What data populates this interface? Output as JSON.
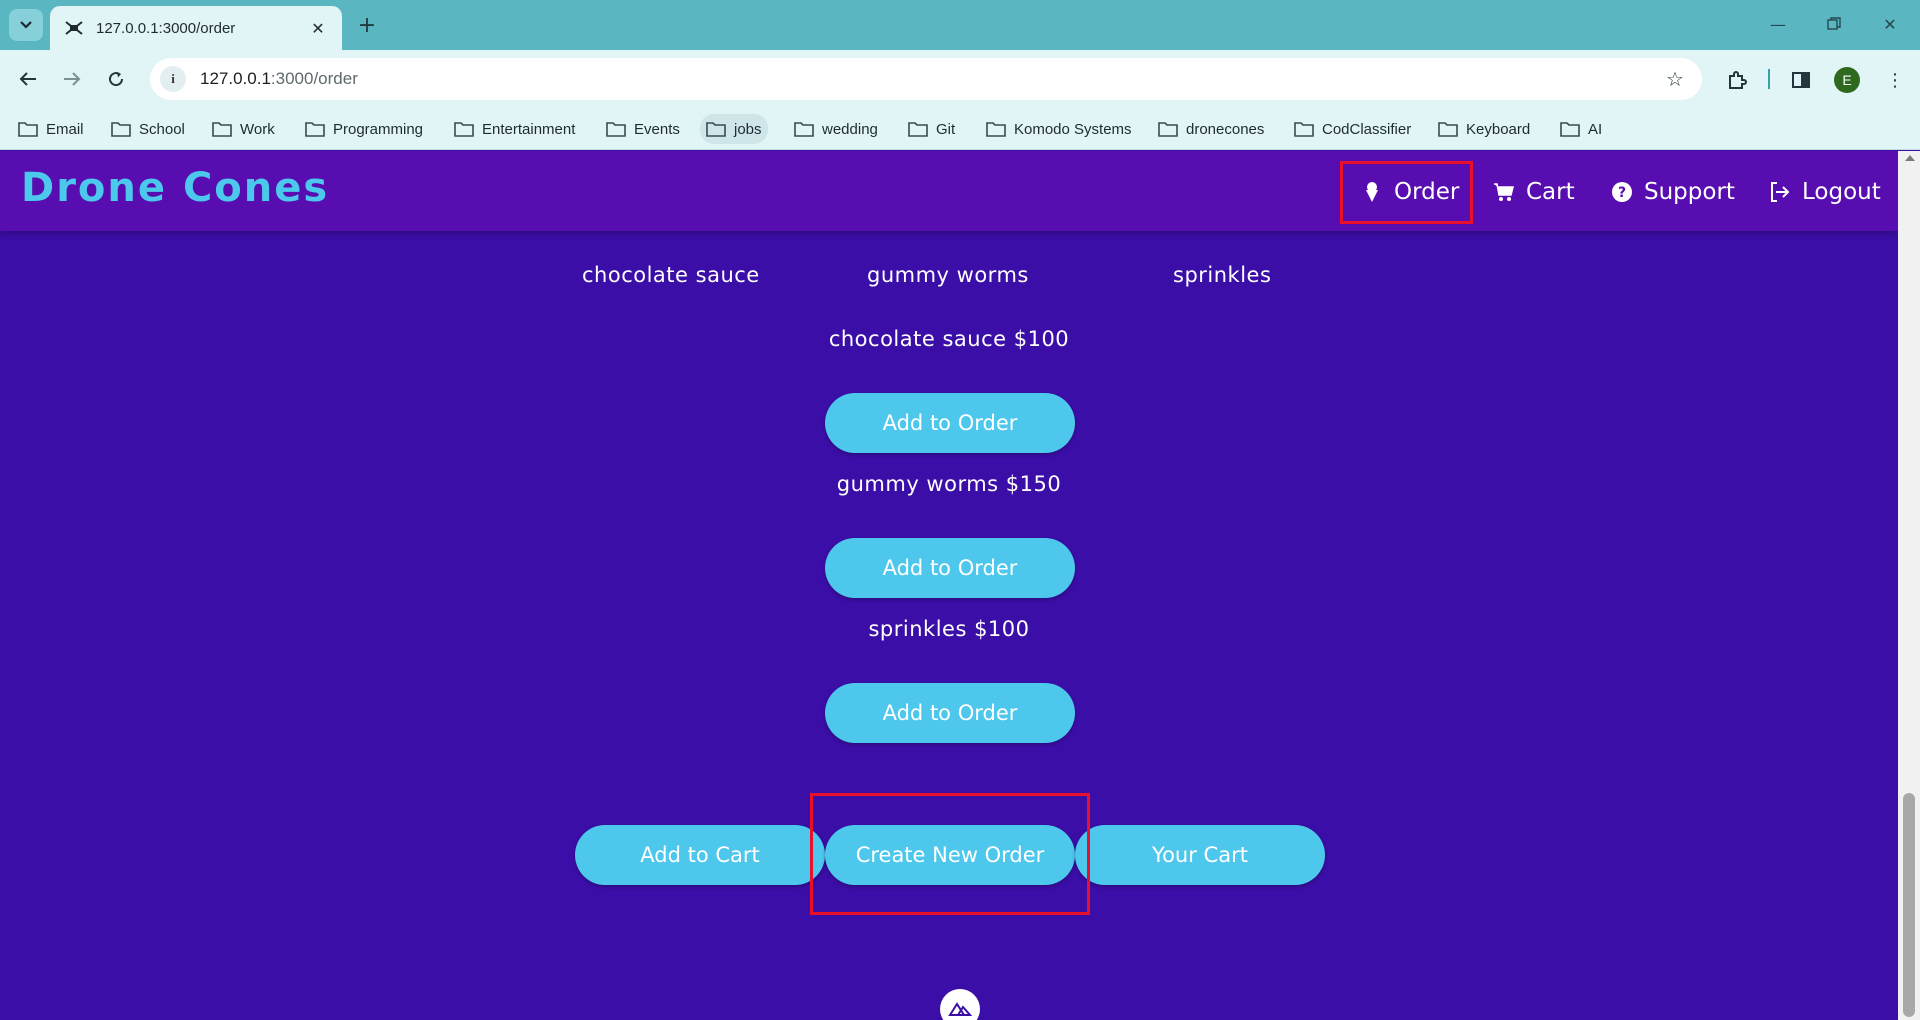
{
  "browser": {
    "tab": {
      "title": "127.0.0.1:3000/order"
    },
    "address": {
      "host": "127.0.0.1",
      "path": ":3000/order"
    },
    "avatar_letter": "E",
    "bookmarks": [
      {
        "label": "Email"
      },
      {
        "label": "School"
      },
      {
        "label": "Work"
      },
      {
        "label": "Programming"
      },
      {
        "label": "Entertainment"
      },
      {
        "label": "Events"
      },
      {
        "label": "jobs"
      },
      {
        "label": "wedding"
      },
      {
        "label": "Git"
      },
      {
        "label": "Komodo Systems"
      },
      {
        "label": "dronecones"
      },
      {
        "label": "CodClassifier"
      },
      {
        "label": "Keyboard"
      },
      {
        "label": "AI"
      }
    ]
  },
  "app": {
    "brand": "Drone Cones",
    "nav": {
      "order": "Order",
      "cart": "Cart",
      "support": "Support",
      "logout": "Logout"
    },
    "toppings_header": [
      "chocolate sauce",
      "gummy worms",
      "sprinkles"
    ],
    "items": [
      {
        "name": "chocolate sauce $100",
        "button": "Add to Order"
      },
      {
        "name": "gummy worms $150",
        "button": "Add to Order"
      },
      {
        "name": "sprinkles $100",
        "button": "Add to Order"
      }
    ],
    "actions": {
      "add_to_cart": "Add to Cart",
      "create_new_order": "Create New Order",
      "your_cart": "Your Cart"
    }
  },
  "colors": {
    "page_bg": "#3b0ea8",
    "navbar_bg": "#580db0",
    "accent": "#4dc8ec",
    "highlight": "#e8102b",
    "browser_chrome": "#5ab7c2"
  }
}
